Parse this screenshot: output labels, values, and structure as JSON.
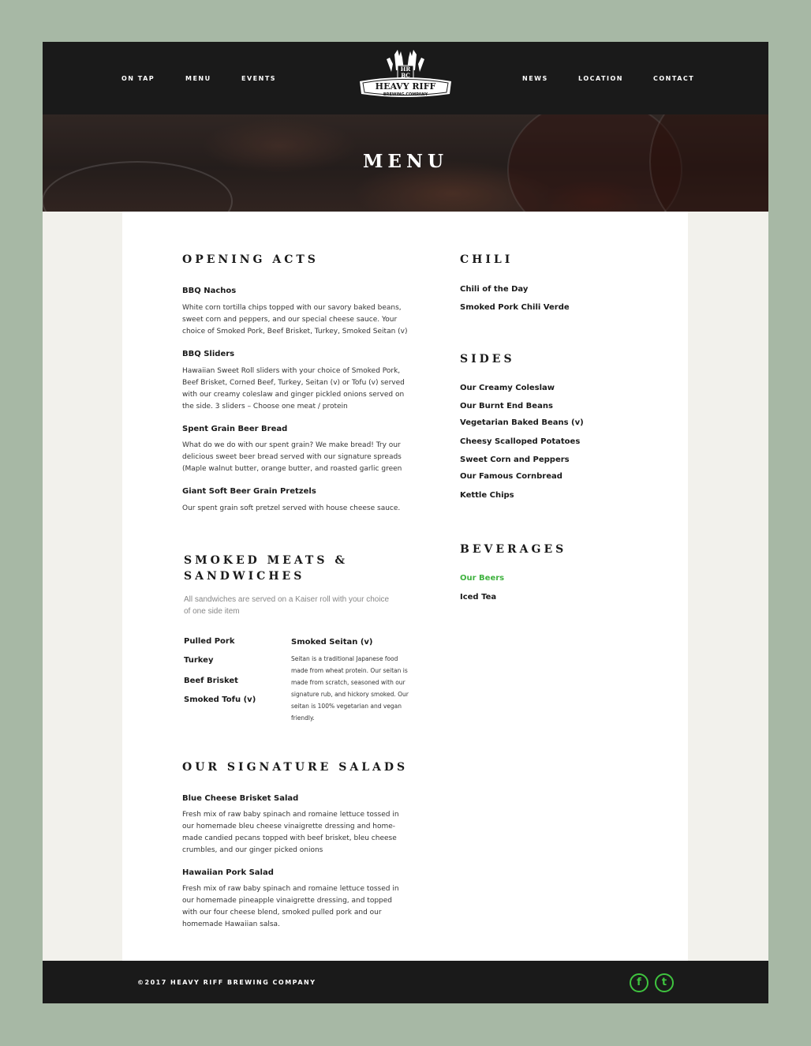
{
  "colors": {
    "page_bg": "#a7b8a5",
    "header_bg": "#1a1a1a",
    "accent": "#3fb23f"
  },
  "nav": {
    "left": [
      "ON TAP",
      "MENU",
      "EVENTS"
    ],
    "right": [
      "NEWS",
      "LOCATION",
      "CONTACT"
    ]
  },
  "logo": {
    "monogram_top": "HR",
    "monogram_bottom": "BC",
    "name": "HEAVY RIFF",
    "tagline": "BREWING COMPANY"
  },
  "hero": {
    "title": "MENU"
  },
  "opening_acts": {
    "heading": "OPENING ACTS",
    "items": [
      {
        "title": "BBQ Nachos",
        "lines": [
          "White corn tortilla chips topped with our savory baked beans,",
          "sweet corn and peppers, and our special cheese sauce. Your",
          "choice of Smoked Pork, Beef Brisket, Turkey, Smoked Seitan (v)"
        ]
      },
      {
        "title": "BBQ Sliders",
        "lines": [
          "Hawaiian Sweet Roll sliders with your choice of Smoked Pork,",
          "Beef Brisket, Corned Beef, Turkey, Seitan (v) or Tofu (v) served",
          "with our creamy coleslaw and ginger pickled onions served on",
          "the side. 3 sliders – Choose one meat / protein"
        ]
      },
      {
        "title": "Spent Grain Beer Bread",
        "lines": [
          "What do we do with our spent grain? We make bread! Try our",
          "delicious sweet beer bread served with our signature spreads",
          "(Maple walnut butter, orange butter, and roasted garlic green"
        ]
      },
      {
        "title": "Giant Soft Beer Grain Pretzels",
        "lines": [
          "Our spent grain soft pretzel served with house cheese sauce."
        ]
      }
    ]
  },
  "smoked": {
    "heading_line1": "SMOKED MEATS &",
    "heading_line2": "SANDWICHES",
    "note_line1": "All sandwiches are served on a Kaiser roll with your choice",
    "note_line2": "of one side item",
    "items": [
      "Pulled Pork",
      "Turkey",
      "Beef Brisket",
      "Smoked Tofu (v)"
    ],
    "seitan": {
      "title": "Smoked Seitan (v)",
      "lines": [
        "Seitan is a traditional Japanese food",
        "made from wheat protein. Our seitan is",
        "made from scratch, seasoned with our",
        "signature rub, and hickory smoked. Our",
        "seitan is 100% vegetarian and vegan",
        "friendly."
      ]
    }
  },
  "salads": {
    "heading": "OUR SIGNATURE SALADS",
    "items": [
      {
        "title": "Blue Cheese Brisket Salad",
        "lines": [
          "Fresh mix of raw baby spinach and romaine lettuce tossed in",
          "our homemade bleu cheese vinaigrette dressing and home-",
          "made candied pecans topped with beef brisket, bleu cheese",
          "crumbles, and our ginger picked onions"
        ]
      },
      {
        "title": "Hawaiian Pork Salad",
        "lines": [
          "Fresh mix of raw baby spinach and romaine lettuce tossed in",
          "our homemade pineapple vinaigrette dressing, and topped",
          "with our four cheese blend, smoked pulled pork and our",
          "homemade Hawaiian salsa."
        ]
      }
    ]
  },
  "chili": {
    "heading": "CHILI",
    "items": [
      "Chili of the Day",
      "Smoked Pork Chili Verde"
    ]
  },
  "sides": {
    "heading": "SIDES",
    "items": [
      "Our Creamy Coleslaw",
      "Our Burnt End Beans",
      "Vegetarian Baked Beans (v)",
      "Cheesy Scalloped Potatoes",
      "Sweet Corn and Peppers",
      "Our Famous Cornbread",
      "Kettle Chips"
    ]
  },
  "beverages": {
    "heading": "BEVERAGES",
    "items": [
      "Our Beers",
      "Iced Tea"
    ]
  },
  "footer": {
    "copyright": "©2017 HEAVY RIFF BREWING COMPANY",
    "facebook_glyph": "f",
    "twitter_glyph": "t",
    "facebook_icon": "facebook-icon",
    "twitter_icon": "twitter-icon"
  }
}
